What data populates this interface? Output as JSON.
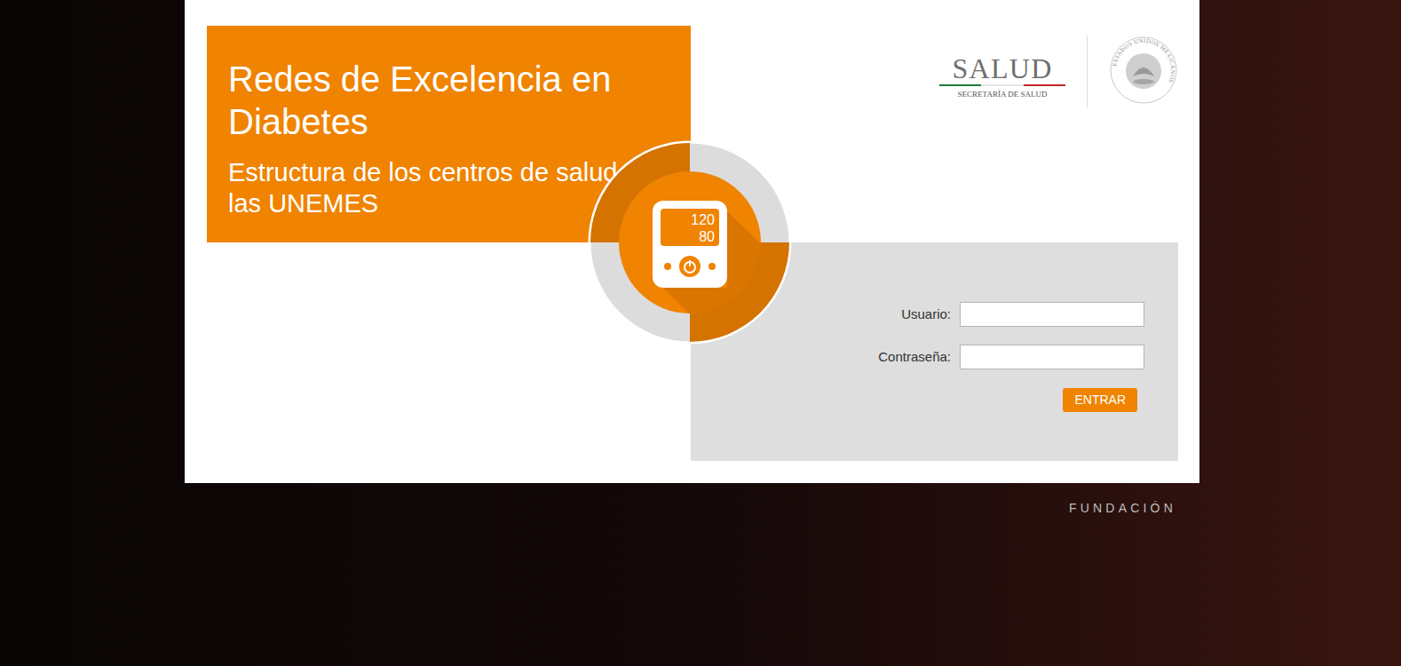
{
  "header": {
    "title": "Redes de Excelencia en Diabetes",
    "subtitle": "Estructura de los centros de salud y las UNEMES"
  },
  "badge": {
    "systolic": "120",
    "diastolic": "80"
  },
  "logo": {
    "name": "SALUD",
    "department": "SECRETARÍA DE SALUD",
    "seal": "ESTADOS UNIDOS MEXICANOS"
  },
  "form": {
    "fields": [
      {
        "label": "Usuario:",
        "value": ""
      },
      {
        "label": "Contraseña:",
        "value": ""
      }
    ],
    "submit": "ENTRAR"
  },
  "footer": {
    "brand": "FUNDACIÓN"
  }
}
